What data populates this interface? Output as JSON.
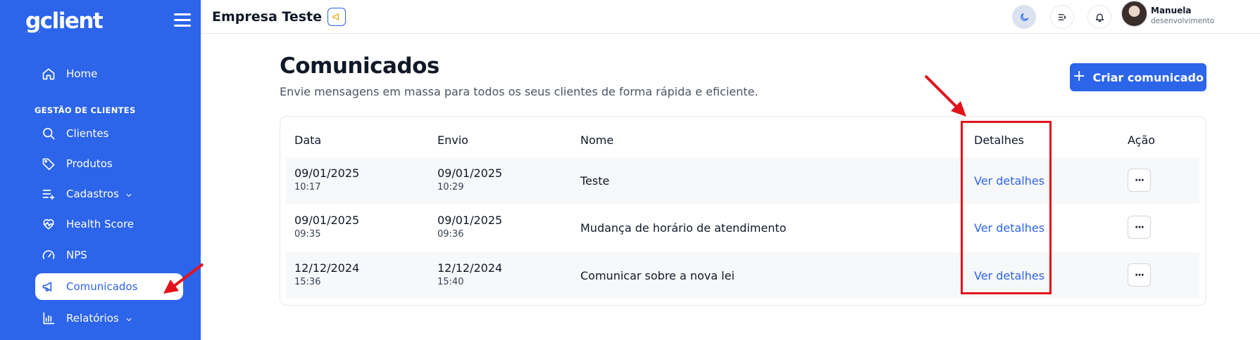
{
  "sidebar": {
    "logo_g": "g",
    "logo_rest": "client",
    "section_title": "GESTÃO DE CLIENTES",
    "items": [
      {
        "label": "Home",
        "icon": "home-icon"
      },
      {
        "label": "Clientes",
        "icon": "search-icon"
      },
      {
        "label": "Produtos",
        "icon": "tag-icon"
      },
      {
        "label": "Cadastros",
        "icon": "list-plus-icon"
      },
      {
        "label": "Health Score",
        "icon": "heart-pulse-icon"
      },
      {
        "label": "NPS",
        "icon": "gauge-icon"
      },
      {
        "label": "Comunicados",
        "icon": "megaphone-icon",
        "active": true
      },
      {
        "label": "Relatórios",
        "icon": "bar-chart-icon"
      }
    ]
  },
  "topbar": {
    "company": "Empresa Teste",
    "user_name": "Manuela",
    "user_role": "desenvolvimento"
  },
  "main": {
    "title": "Comunicados",
    "subtitle": "Envie mensagens em massa para todos os seus clientes de forma rápida e eficiente.",
    "create_button": "Criar comunicado",
    "columns": [
      "Data",
      "Envio",
      "Nome",
      "Detalhes",
      "Ação"
    ],
    "rows": [
      {
        "data": "09/01/2025",
        "data_time": "10:17",
        "envio": "09/01/2025",
        "envio_time": "10:29",
        "nome": "Teste",
        "detalhes": "Ver detalhes",
        "acao": "···"
      },
      {
        "data": "09/01/2025",
        "data_time": "09:35",
        "envio": "09/01/2025",
        "envio_time": "09:36",
        "nome": "Mudança de horário de atendimento",
        "detalhes": "Ver detalhes",
        "acao": "···"
      },
      {
        "data": "12/12/2024",
        "data_time": "15:36",
        "envio": "12/12/2024",
        "envio_time": "15:40",
        "nome": "Comunicar sobre a nova lei",
        "detalhes": "Ver detalhes",
        "acao": "···"
      }
    ]
  },
  "colors": {
    "brand": "#2c64ea",
    "annotation": "#e3121b",
    "logo_accent": "#f6c445"
  }
}
